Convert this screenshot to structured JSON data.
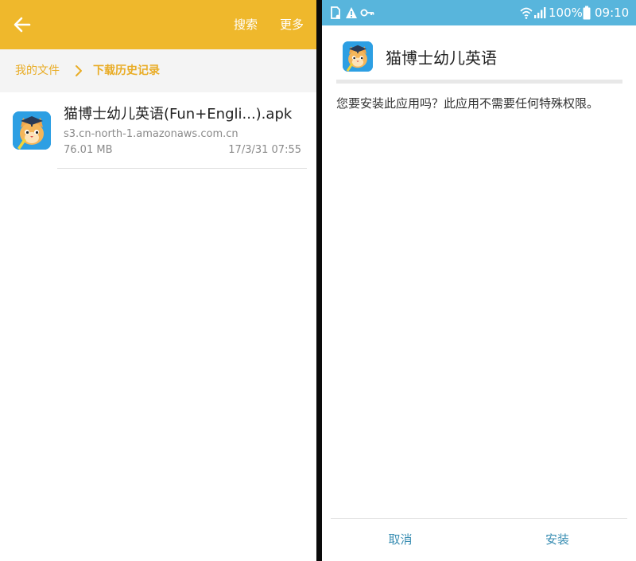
{
  "file_manager": {
    "toolbar": {
      "back_icon": "arrow-left-icon",
      "search_label": "搜索",
      "more_label": "更多"
    },
    "breadcrumb": {
      "root": "我的文件",
      "separator_icon": "chevron-right-icon",
      "current": "下载历史记录"
    },
    "file": {
      "icon": "cat-doctor-app-icon",
      "name": "猫博士幼儿英语(Fun+Engli...).apk",
      "source": "s3.cn-north-1.amazonaws.com.cn",
      "size": "76.01 MB",
      "date": "17/3/31 07:55"
    }
  },
  "installer": {
    "status_bar": {
      "battery": "100%",
      "time": "09:10",
      "icons": [
        "sd-card-icon",
        "warning-icon",
        "key-icon",
        "wifi-icon",
        "signal-icon",
        "battery-icon"
      ]
    },
    "dialog": {
      "app_icon": "cat-doctor-app-icon",
      "title": "猫博士幼儿英语",
      "message": "您要安装此应用吗？此应用不需要任何特殊权限。",
      "cancel_label": "取消",
      "install_label": "安装"
    }
  },
  "colors": {
    "toolbar": "#efb82c",
    "breadcrumb_text": "#e9ac25",
    "status_bar": "#58b5dc",
    "dialog_button": "#3a8eb3"
  }
}
